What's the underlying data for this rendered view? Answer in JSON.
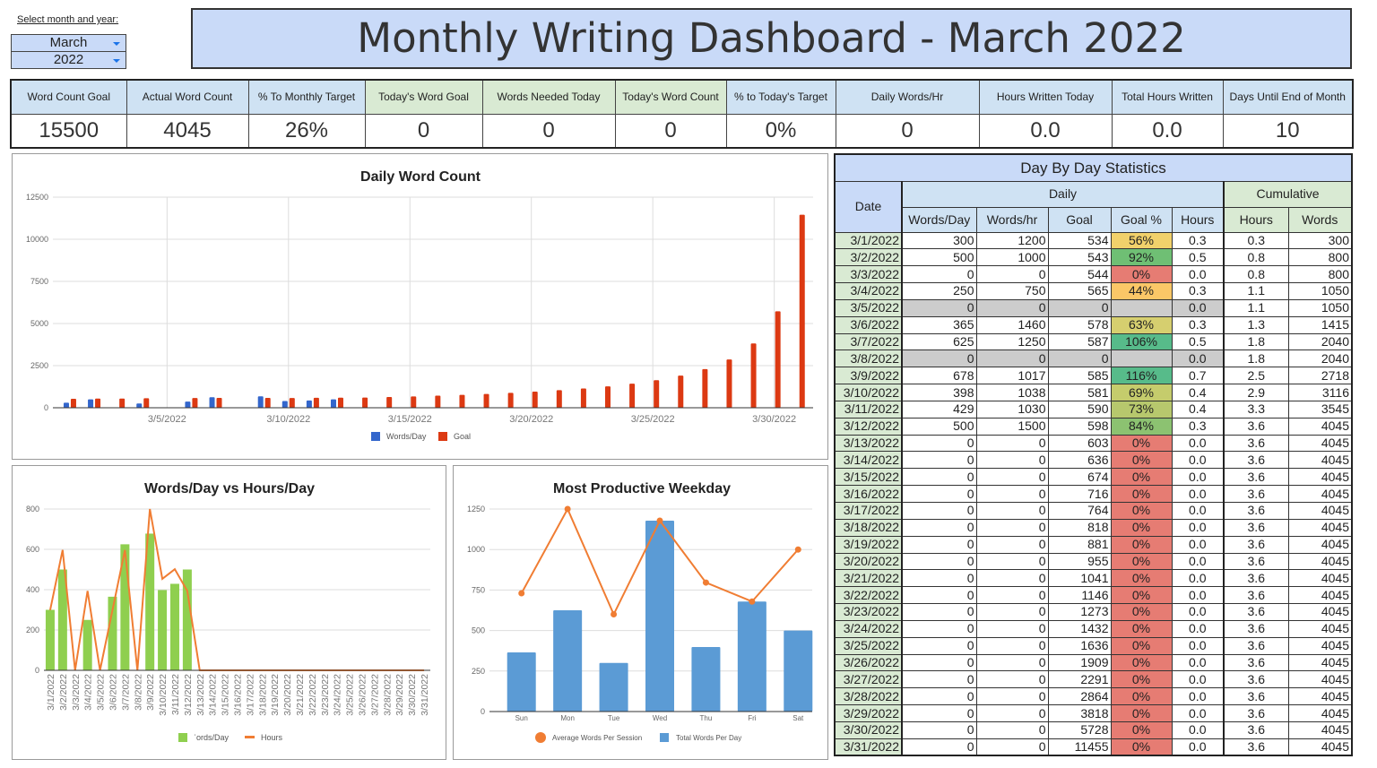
{
  "selector": {
    "label": "Select month and year:",
    "month": "March",
    "year": "2022"
  },
  "title": "Monthly Writing Dashboard - March 2022",
  "kpis": [
    {
      "label": "Word Count Goal",
      "value": "15500",
      "color": "blue"
    },
    {
      "label": "Actual Word Count",
      "value": "4045",
      "color": "blue"
    },
    {
      "label": "% To Monthly Target",
      "value": "26%",
      "color": "blue"
    },
    {
      "label": "Today's Word Goal",
      "value": "0",
      "color": "green"
    },
    {
      "label": "Words Needed Today",
      "value": "0",
      "color": "green"
    },
    {
      "label": "Today's Word Count",
      "value": "0",
      "color": "green"
    },
    {
      "label": "% to Today's Target",
      "value": "0%",
      "color": "blue"
    },
    {
      "label": "Daily Words/Hr",
      "value": "0",
      "color": "blue"
    },
    {
      "label": "Hours Written Today",
      "value": "0.0",
      "color": "blue"
    },
    {
      "label": "Total Hours Written",
      "value": "0.0",
      "color": "blue"
    },
    {
      "label": "Days Until End of Month",
      "value": "10",
      "color": "blue"
    }
  ],
  "colors": {
    "header_blue": "#cfe2f3",
    "title_blue": "#c9daf8",
    "header_green": "#d9ead3",
    "goal_pct_red": "#e67c73",
    "goal_pct_green": "#57bb8a",
    "grey_row": "#cccccc",
    "words_blue": "#3366cc",
    "goal_red": "#dc3912",
    "green_bar": "#8fcf4f",
    "orange_line": "#f07d33",
    "weekday_blue": "#5b9bd5"
  },
  "day_table": {
    "title": "Day By Day Statistics",
    "date_header": "Date",
    "daily_header": "Daily",
    "cumulative_header": "Cumulative",
    "columns": [
      "Words/Day",
      "Words/hr",
      "Goal",
      "Goal %",
      "Hours",
      "Hours",
      "Words"
    ],
    "rows": [
      {
        "date": "3/1/2022",
        "words": "300",
        "wph": "1200",
        "goal": "534",
        "pct": "56%",
        "pct_color": "#f1d16b",
        "hours": "0.3",
        "cum_hours": "0.3",
        "cum_words": "300"
      },
      {
        "date": "3/2/2022",
        "words": "500",
        "wph": "1000",
        "goal": "543",
        "pct": "92%",
        "pct_color": "#6fbf74",
        "hours": "0.5",
        "cum_hours": "0.8",
        "cum_words": "800"
      },
      {
        "date": "3/3/2022",
        "words": "0",
        "wph": "0",
        "goal": "544",
        "pct": "0%",
        "pct_color": "#e67c73",
        "hours": "0.0",
        "cum_hours": "0.8",
        "cum_words": "800"
      },
      {
        "date": "3/4/2022",
        "words": "250",
        "wph": "750",
        "goal": "565",
        "pct": "44%",
        "pct_color": "#fbc767",
        "hours": "0.3",
        "cum_hours": "1.1",
        "cum_words": "1050"
      },
      {
        "date": "3/5/2022",
        "words": "0",
        "wph": "0",
        "goal": "0",
        "pct": "",
        "pct_color": "#cccccc",
        "hours": "0.0",
        "cum_hours": "1.1",
        "cum_words": "1050",
        "grey": true
      },
      {
        "date": "3/6/2022",
        "words": "365",
        "wph": "1460",
        "goal": "578",
        "pct": "63%",
        "pct_color": "#d6cf6f",
        "hours": "0.3",
        "cum_hours": "1.3",
        "cum_words": "1415"
      },
      {
        "date": "3/7/2022",
        "words": "625",
        "wph": "1250",
        "goal": "587",
        "pct": "106%",
        "pct_color": "#57bb8a",
        "hours": "0.5",
        "cum_hours": "1.8",
        "cum_words": "2040"
      },
      {
        "date": "3/8/2022",
        "words": "0",
        "wph": "0",
        "goal": "0",
        "pct": "",
        "pct_color": "#cccccc",
        "hours": "0.0",
        "cum_hours": "1.8",
        "cum_words": "2040",
        "grey": true
      },
      {
        "date": "3/9/2022",
        "words": "678",
        "wph": "1017",
        "goal": "585",
        "pct": "116%",
        "pct_color": "#57bb8a",
        "hours": "0.7",
        "cum_hours": "2.5",
        "cum_words": "2718"
      },
      {
        "date": "3/10/2022",
        "words": "398",
        "wph": "1038",
        "goal": "581",
        "pct": "69%",
        "pct_color": "#c5cc6c",
        "hours": "0.4",
        "cum_hours": "2.9",
        "cum_words": "3116"
      },
      {
        "date": "3/11/2022",
        "words": "429",
        "wph": "1030",
        "goal": "590",
        "pct": "73%",
        "pct_color": "#b7c86d",
        "hours": "0.4",
        "cum_hours": "3.3",
        "cum_words": "3545"
      },
      {
        "date": "3/12/2022",
        "words": "500",
        "wph": "1500",
        "goal": "598",
        "pct": "84%",
        "pct_color": "#8cc271",
        "hours": "0.3",
        "cum_hours": "3.6",
        "cum_words": "4045"
      },
      {
        "date": "3/13/2022",
        "words": "0",
        "wph": "0",
        "goal": "603",
        "pct": "0%",
        "pct_color": "#e67c73",
        "hours": "0.0",
        "cum_hours": "3.6",
        "cum_words": "4045"
      },
      {
        "date": "3/14/2022",
        "words": "0",
        "wph": "0",
        "goal": "636",
        "pct": "0%",
        "pct_color": "#e67c73",
        "hours": "0.0",
        "cum_hours": "3.6",
        "cum_words": "4045"
      },
      {
        "date": "3/15/2022",
        "words": "0",
        "wph": "0",
        "goal": "674",
        "pct": "0%",
        "pct_color": "#e67c73",
        "hours": "0.0",
        "cum_hours": "3.6",
        "cum_words": "4045"
      },
      {
        "date": "3/16/2022",
        "words": "0",
        "wph": "0",
        "goal": "716",
        "pct": "0%",
        "pct_color": "#e67c73",
        "hours": "0.0",
        "cum_hours": "3.6",
        "cum_words": "4045"
      },
      {
        "date": "3/17/2022",
        "words": "0",
        "wph": "0",
        "goal": "764",
        "pct": "0%",
        "pct_color": "#e67c73",
        "hours": "0.0",
        "cum_hours": "3.6",
        "cum_words": "4045"
      },
      {
        "date": "3/18/2022",
        "words": "0",
        "wph": "0",
        "goal": "818",
        "pct": "0%",
        "pct_color": "#e67c73",
        "hours": "0.0",
        "cum_hours": "3.6",
        "cum_words": "4045"
      },
      {
        "date": "3/19/2022",
        "words": "0",
        "wph": "0",
        "goal": "881",
        "pct": "0%",
        "pct_color": "#e67c73",
        "hours": "0.0",
        "cum_hours": "3.6",
        "cum_words": "4045"
      },
      {
        "date": "3/20/2022",
        "words": "0",
        "wph": "0",
        "goal": "955",
        "pct": "0%",
        "pct_color": "#e67c73",
        "hours": "0.0",
        "cum_hours": "3.6",
        "cum_words": "4045"
      },
      {
        "date": "3/21/2022",
        "words": "0",
        "wph": "0",
        "goal": "1041",
        "pct": "0%",
        "pct_color": "#e67c73",
        "hours": "0.0",
        "cum_hours": "3.6",
        "cum_words": "4045"
      },
      {
        "date": "3/22/2022",
        "words": "0",
        "wph": "0",
        "goal": "1146",
        "pct": "0%",
        "pct_color": "#e67c73",
        "hours": "0.0",
        "cum_hours": "3.6",
        "cum_words": "4045"
      },
      {
        "date": "3/23/2022",
        "words": "0",
        "wph": "0",
        "goal": "1273",
        "pct": "0%",
        "pct_color": "#e67c73",
        "hours": "0.0",
        "cum_hours": "3.6",
        "cum_words": "4045"
      },
      {
        "date": "3/24/2022",
        "words": "0",
        "wph": "0",
        "goal": "1432",
        "pct": "0%",
        "pct_color": "#e67c73",
        "hours": "0.0",
        "cum_hours": "3.6",
        "cum_words": "4045"
      },
      {
        "date": "3/25/2022",
        "words": "0",
        "wph": "0",
        "goal": "1636",
        "pct": "0%",
        "pct_color": "#e67c73",
        "hours": "0.0",
        "cum_hours": "3.6",
        "cum_words": "4045"
      },
      {
        "date": "3/26/2022",
        "words": "0",
        "wph": "0",
        "goal": "1909",
        "pct": "0%",
        "pct_color": "#e67c73",
        "hours": "0.0",
        "cum_hours": "3.6",
        "cum_words": "4045"
      },
      {
        "date": "3/27/2022",
        "words": "0",
        "wph": "0",
        "goal": "2291",
        "pct": "0%",
        "pct_color": "#e67c73",
        "hours": "0.0",
        "cum_hours": "3.6",
        "cum_words": "4045"
      },
      {
        "date": "3/28/2022",
        "words": "0",
        "wph": "0",
        "goal": "2864",
        "pct": "0%",
        "pct_color": "#e67c73",
        "hours": "0.0",
        "cum_hours": "3.6",
        "cum_words": "4045"
      },
      {
        "date": "3/29/2022",
        "words": "0",
        "wph": "0",
        "goal": "3818",
        "pct": "0%",
        "pct_color": "#e67c73",
        "hours": "0.0",
        "cum_hours": "3.6",
        "cum_words": "4045"
      },
      {
        "date": "3/30/2022",
        "words": "0",
        "wph": "0",
        "goal": "5728",
        "pct": "0%",
        "pct_color": "#e67c73",
        "hours": "0.0",
        "cum_hours": "3.6",
        "cum_words": "4045"
      },
      {
        "date": "3/31/2022",
        "words": "0",
        "wph": "0",
        "goal": "11455",
        "pct": "0%",
        "pct_color": "#e67c73",
        "hours": "0.0",
        "cum_hours": "3.6",
        "cum_words": "4045"
      }
    ]
  },
  "chart_data": [
    {
      "id": "daily",
      "type": "bar",
      "title": "Daily Word Count",
      "categories": [
        "3/1/2022",
        "3/2/2022",
        "3/3/2022",
        "3/4/2022",
        "3/5/2022",
        "3/6/2022",
        "3/7/2022",
        "3/8/2022",
        "3/9/2022",
        "3/10/2022",
        "3/11/2022",
        "3/12/2022",
        "3/13/2022",
        "3/14/2022",
        "3/15/2022",
        "3/16/2022",
        "3/17/2022",
        "3/18/2022",
        "3/19/2022",
        "3/20/2022",
        "3/21/2022",
        "3/22/2022",
        "3/23/2022",
        "3/24/2022",
        "3/25/2022",
        "3/26/2022",
        "3/27/2022",
        "3/28/2022",
        "3/29/2022",
        "3/30/2022",
        "3/31/2022"
      ],
      "x_tick_labels": [
        "3/5/2022",
        "3/10/2022",
        "3/15/2022",
        "3/20/2022",
        "3/25/2022",
        "3/30/2022"
      ],
      "x_tick_days": [
        5,
        10,
        15,
        20,
        25,
        30
      ],
      "series": [
        {
          "name": "Words/Day",
          "color": "#3366cc",
          "values": [
            300,
            500,
            0,
            250,
            0,
            365,
            625,
            0,
            678,
            398,
            429,
            500,
            0,
            0,
            0,
            0,
            0,
            0,
            0,
            0,
            0,
            0,
            0,
            0,
            0,
            0,
            0,
            0,
            0,
            0,
            0
          ]
        },
        {
          "name": "Goal",
          "color": "#dc3912",
          "values": [
            534,
            543,
            544,
            565,
            0,
            578,
            587,
            0,
            585,
            581,
            590,
            598,
            603,
            636,
            674,
            716,
            764,
            818,
            881,
            955,
            1041,
            1146,
            1273,
            1432,
            1636,
            1909,
            2291,
            2864,
            3818,
            5728,
            11455
          ]
        }
      ],
      "y_ticks": [
        0,
        2500,
        5000,
        7500,
        10000,
        12500
      ],
      "ylim": [
        0,
        12500
      ],
      "legend": "bottom"
    },
    {
      "id": "wvh",
      "type": "bar",
      "title": "Words/Day vs Hours/Day",
      "categories": [
        "3/1/2022",
        "3/2/2022",
        "3/3/2022",
        "3/4/2022",
        "3/5/2022",
        "3/6/2022",
        "3/7/2022",
        "3/8/2022",
        "3/9/2022",
        "3/10/2022",
        "3/11/2022",
        "3/12/2022",
        "3/13/2022",
        "3/14/2022",
        "3/15/2022",
        "3/16/2022",
        "3/17/2022",
        "3/18/2022",
        "3/19/2022",
        "3/20/2022",
        "3/21/2022",
        "3/22/2022",
        "3/23/2022",
        "3/24/2022",
        "3/25/2022",
        "3/26/2022",
        "3/27/2022",
        "3/28/2022",
        "3/29/2022",
        "3/30/2022",
        "3/31/2022"
      ],
      "series": [
        {
          "name": "Words/Day",
          "legend_label": "ʿords/Day",
          "type": "bar",
          "color": "#8fcf4f",
          "values": [
            300,
            500,
            0,
            250,
            0,
            365,
            625,
            0,
            678,
            398,
            429,
            500,
            0,
            0,
            0,
            0,
            0,
            0,
            0,
            0,
            0,
            0,
            0,
            0,
            0,
            0,
            0,
            0,
            0,
            0,
            0
          ]
        },
        {
          "name": "Hours",
          "type": "line",
          "axis": "right",
          "color": "#f07d33",
          "values": [
            0.25,
            0.5,
            0,
            0.33,
            0,
            0.25,
            0.5,
            0,
            0.67,
            0.38,
            0.42,
            0.33,
            0,
            0,
            0,
            0,
            0,
            0,
            0,
            0,
            0,
            0,
            0,
            0,
            0,
            0,
            0,
            0,
            0,
            0,
            0
          ]
        }
      ],
      "y_ticks": [
        0,
        200,
        400,
        600,
        800
      ],
      "ylim": [
        0,
        800
      ],
      "y2lim": [
        0,
        0.67
      ],
      "legend": "bottom"
    },
    {
      "id": "week",
      "type": "bar",
      "title": "Most Productive Weekday",
      "categories": [
        "Sun",
        "Mon",
        "Tue",
        "Wed",
        "Thu",
        "Fri",
        "Sat"
      ],
      "series": [
        {
          "name": "Average Words Per Session",
          "type": "line",
          "color": "#f07d33",
          "values": [
            730,
            1250,
            600,
            1178,
            796,
            679,
            1000
          ]
        },
        {
          "name": "Total Words Per Day",
          "type": "bar",
          "color": "#5b9bd5",
          "values": [
            365,
            625,
            300,
            1178,
            398,
            679,
            500
          ]
        }
      ],
      "y_ticks": [
        0,
        250,
        500,
        750,
        1000,
        1250
      ],
      "ylim": [
        0,
        1250
      ],
      "legend": "bottom"
    }
  ]
}
